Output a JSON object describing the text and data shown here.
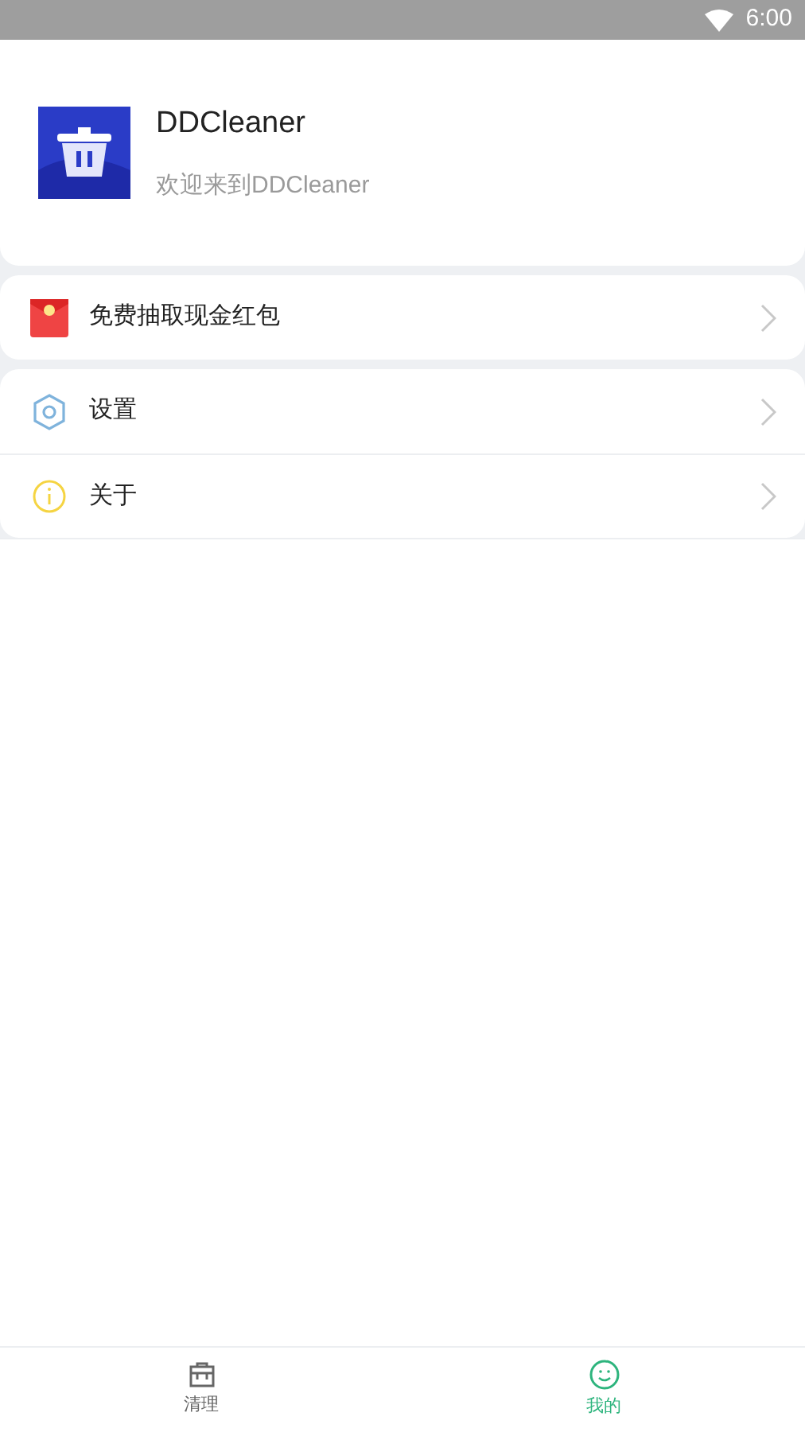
{
  "status_bar": {
    "time": "6:00"
  },
  "profile": {
    "app_name": "DDCleaner",
    "subtitle": "欢迎来到DDCleaner"
  },
  "menu_groups": [
    [
      {
        "kind": "red-packet",
        "label": "免费抽取现金红包"
      }
    ],
    [
      {
        "kind": "settings",
        "label": "设置"
      },
      {
        "kind": "info",
        "label": "关于"
      }
    ]
  ],
  "tabs": [
    {
      "kind": "clean",
      "label": "清理",
      "selected": false
    },
    {
      "kind": "me",
      "label": "我的",
      "selected": true
    }
  ]
}
